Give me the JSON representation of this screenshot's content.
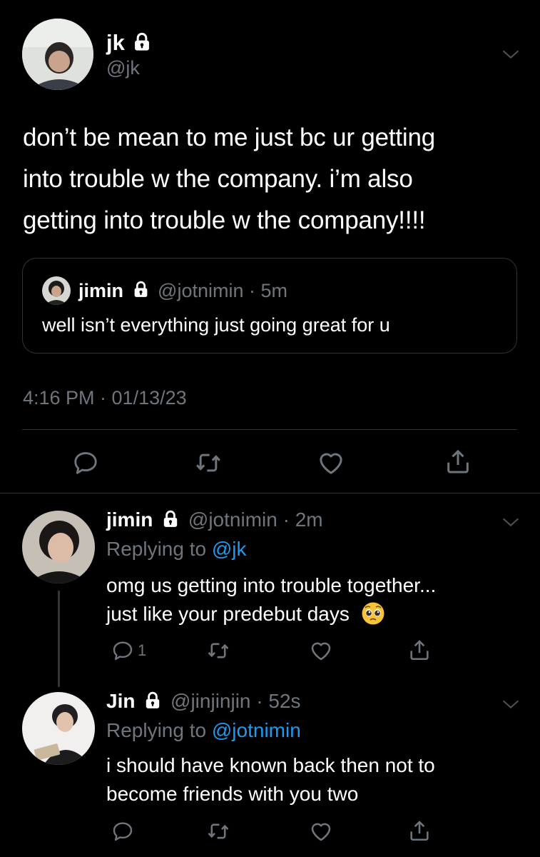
{
  "main_tweet": {
    "display_name": "jk",
    "handle": "@jk",
    "text_lines": [
      "don’t be mean to me just bc ur getting",
      "into trouble w the company. i’m also",
      "getting into trouble w the company!!!!"
    ],
    "quote": {
      "display_name": "jimin",
      "handle": "@jotnimin",
      "sep": "·",
      "time": "5m",
      "text": "well isn’t everything just going great for u"
    },
    "timestamp": "4:16 PM · 01/13/23"
  },
  "replies": [
    {
      "display_name": "jimin",
      "handle": "@jotnimin",
      "sep": "·",
      "time": "2m",
      "replying_label": "Replying to ",
      "replying_to": "@jk",
      "text_lines": [
        "omg us getting into trouble together...",
        "just like your predebut days"
      ],
      "emoji": "pleading-face-emoji",
      "reply_count": "1"
    },
    {
      "display_name": "Jin",
      "handle": "@jinjinjin",
      "sep": "·",
      "time": "52s",
      "replying_label": "Replying to ",
      "replying_to": "@jotnimin",
      "text_lines": [
        "i should have known back then not to",
        "become friends with you two"
      ]
    }
  ],
  "colors": {
    "background": "#000000",
    "muted": "#6e767d",
    "link": "#1d9bf0",
    "divider": "#2f3336"
  }
}
